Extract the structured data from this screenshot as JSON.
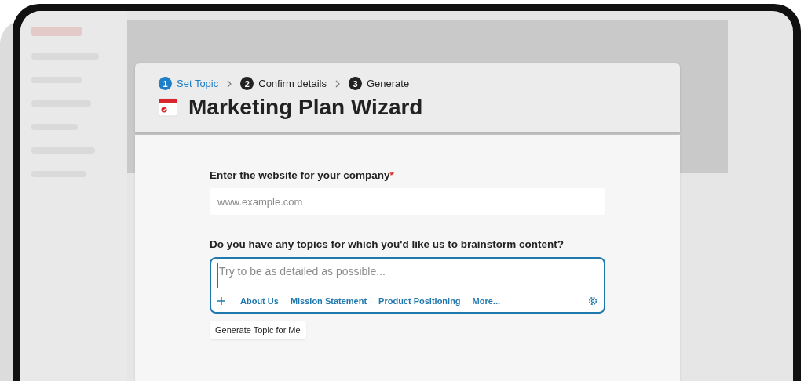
{
  "steps": [
    {
      "number": "1",
      "label": "Set Topic",
      "selected": true
    },
    {
      "number": "2",
      "label": "Confirm details",
      "selected": false
    },
    {
      "number": "3",
      "label": "Generate",
      "selected": false
    }
  ],
  "title": "Marketing Plan Wizard",
  "fields": [
    {
      "kind": "input",
      "label": "Enter the website for your company",
      "required_mark": "*",
      "placeholder": "www.example.com",
      "focused": false
    },
    {
      "kind": "textarea",
      "label": "Do you have any topics for which you'd like us to brainstorm content?",
      "placeholder": "Try to be as detailed as possible...",
      "focused": true,
      "chips": [
        "About Us",
        "Mission Statement",
        "Product Positioning",
        "More..."
      ]
    }
  ],
  "button": "Generate Topic for Me"
}
